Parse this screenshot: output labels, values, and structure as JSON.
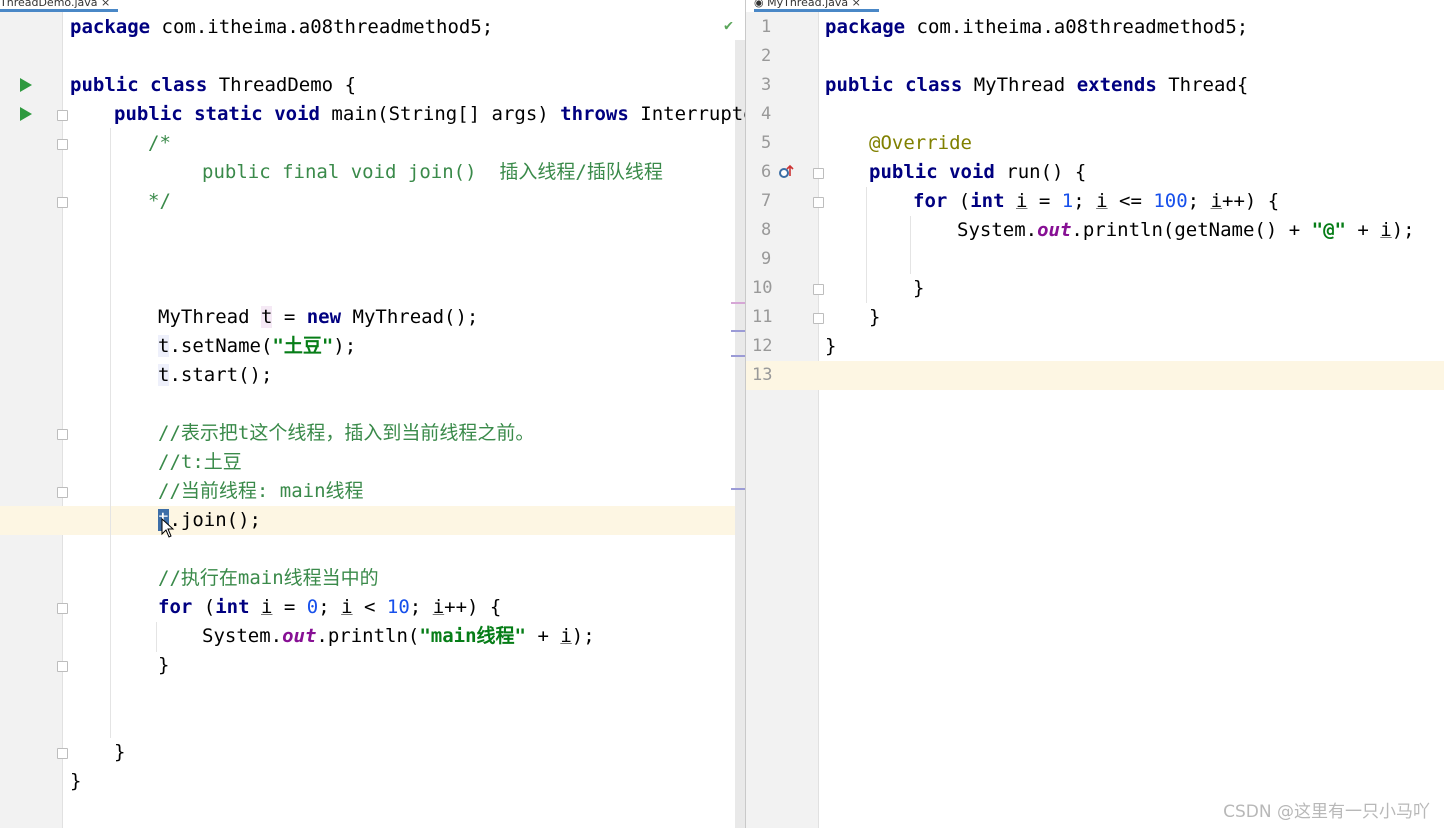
{
  "tabs": {
    "left": "ThreadDemo.java",
    "right": "MyThread.java"
  },
  "left_editor": {
    "lines": {
      "l1_kw": "package",
      "l1_rest": " com.itheima.a08threadmethod5;",
      "l3_kw1": "public",
      "l3_kw2": "class",
      "l3_rest": " ThreadDemo {",
      "l4_kw1": "public",
      "l4_kw2": "static",
      "l4_kw3": "void",
      "l4_mid": " main(String[] args) ",
      "l4_kw4": "throws",
      "l4_rest": " InterruptedE",
      "c1": "/*",
      "c2": "public final void join()  插入线程/插队线程",
      "c3": "*/",
      "s1_a": "MyThread ",
      "s1_t": "t",
      "s1_b": " = ",
      "s1_kw": "new",
      "s1_c": " MyThread();",
      "s2_t": "t",
      "s2_a": ".setName(",
      "s2_str": "\"土豆\"",
      "s2_b": ");",
      "s3_t": "t",
      "s3_a": ".start();",
      "cm1": "//表示把t这个线程，插入到当前线程之前。",
      "cm2": "//t:土豆",
      "cm3": "//当前线程: main线程",
      "j_t": "t",
      "j_rest": ".join();",
      "cm4": "//执行在main线程当中的",
      "f_kw": "for",
      "f_a": " (",
      "f_kw2": "int",
      "f_b": " ",
      "f_i": "i",
      "f_c": " = ",
      "f_n": "0",
      "f_d": "; ",
      "f_i2": "i",
      "f_e": " < ",
      "f_n2": "10",
      "f_f": "; ",
      "f_i3": "i",
      "f_g": "++) {",
      "p_a": "System.",
      "p_out": "out",
      "p_b": ".println(",
      "p_str": "\"main线程\"",
      "p_c": " + ",
      "p_i": "i",
      "p_d": ");",
      "close_for": "}",
      "close_main": "}",
      "close_class": "}"
    }
  },
  "right_editor": {
    "line_numbers": [
      "1",
      "2",
      "3",
      "4",
      "5",
      "6",
      "7",
      "8",
      "9",
      "10",
      "11",
      "12",
      "13"
    ],
    "lines": {
      "l1_kw": "package",
      "l1_rest": " com.itheima.a08threadmethod5;",
      "l3_kw1": "public",
      "l3_kw2": "class",
      "l3_a": " MyThread ",
      "l3_kw3": "extends",
      "l3_b": " Thread{",
      "l5_ann": "@Override",
      "l6_kw1": "public",
      "l6_kw2": "void",
      "l6_rest": " run() {",
      "l7_kw": "for",
      "l7_a": " (",
      "l7_kw2": "int",
      "l7_b": " ",
      "l7_i": "i",
      "l7_c": " = ",
      "l7_n": "1",
      "l7_d": "; ",
      "l7_i2": "i",
      "l7_e": " <= ",
      "l7_n2": "100",
      "l7_f": "; ",
      "l7_i3": "i",
      "l7_g": "++) {",
      "l8_a": "System.",
      "l8_out": "out",
      "l8_b": ".println(getName() + ",
      "l8_str": "\"@\"",
      "l8_c": " + ",
      "l8_i": "i",
      "l8_d": ");",
      "l10": "}",
      "l11": "}",
      "l12": "}"
    }
  },
  "watermark": "CSDN @这里有一只小马吖",
  "colors": {
    "keyword": "#000080",
    "string": "#067d17",
    "comment": "#3a8a4a",
    "number": "#1750eb",
    "annotation": "#808000",
    "field": "#871094",
    "current_line": "#fdf6e3"
  },
  "icons": [
    "run-icon",
    "fold-icon",
    "check-icon",
    "override-icon",
    "mouse-cursor-icon"
  ]
}
